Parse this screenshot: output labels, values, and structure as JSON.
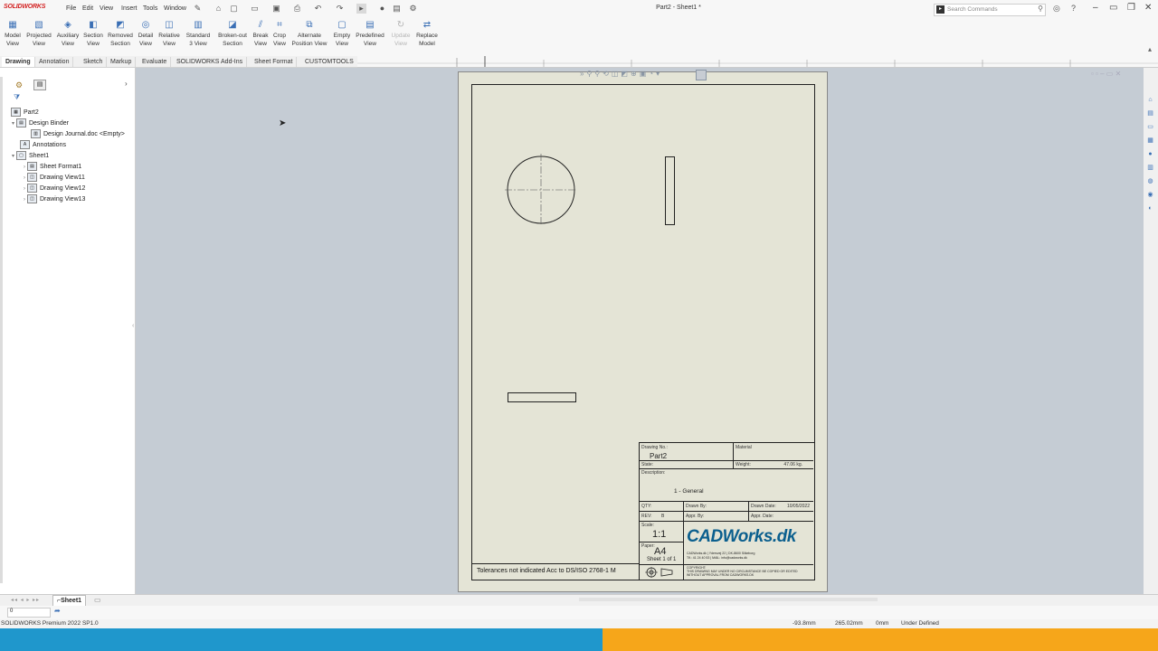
{
  "app": {
    "logo_text": "SOLIDWORKS",
    "title": "Part2 - Sheet1 *",
    "menu": [
      "File",
      "Edit",
      "View",
      "Insert",
      "Tools",
      "Window"
    ],
    "search_placeholder": "Search Commands"
  },
  "ribbon": {
    "buttons": [
      {
        "label": "Model\nView",
        "icon": "model-view-icon",
        "enabled": true
      },
      {
        "label": "Projected\nView",
        "icon": "projected-view-icon",
        "enabled": true
      },
      {
        "label": "Auxiliary\nView",
        "icon": "auxiliary-view-icon",
        "enabled": true
      },
      {
        "label": "Section\nView",
        "icon": "section-view-icon",
        "enabled": true
      },
      {
        "label": "Removed\nSection",
        "icon": "removed-section-icon",
        "enabled": true
      },
      {
        "label": "Detail\nView",
        "icon": "detail-view-icon",
        "enabled": true
      },
      {
        "label": "Relative\nView",
        "icon": "relative-view-icon",
        "enabled": true
      },
      {
        "label": "Standard\n3 View",
        "icon": "standard-3-view-icon",
        "enabled": true
      },
      {
        "label": "Broken-out\nSection",
        "icon": "broken-out-section-icon",
        "enabled": true
      },
      {
        "label": "Break\nView",
        "icon": "break-view-icon",
        "enabled": true
      },
      {
        "label": "Crop\nView",
        "icon": "crop-view-icon",
        "enabled": true
      },
      {
        "label": "Alternate\nPosition View",
        "icon": "alternate-position-view-icon",
        "enabled": true
      },
      {
        "label": "Empty\nView",
        "icon": "empty-view-icon",
        "enabled": true
      },
      {
        "label": "Predefined\nView",
        "icon": "predefined-view-icon",
        "enabled": true
      },
      {
        "label": "Update\nView",
        "icon": "update-view-icon",
        "enabled": false
      },
      {
        "label": "Replace\nModel",
        "icon": "replace-model-icon",
        "enabled": true
      }
    ]
  },
  "tabs": [
    "Drawing",
    "Annotation",
    "Sketch",
    "Markup",
    "Evaluate",
    "SOLIDWORKS Add-Ins",
    "Sheet Format",
    "CUSTOMTOOLS"
  ],
  "active_tab": "Drawing",
  "tree": {
    "root": "Part2",
    "design_binder": "Design Binder",
    "design_journal": "Design Journal.doc <Empty>",
    "annotations": "Annotations",
    "sheet": "Sheet1",
    "sheet_format": "Sheet Format1",
    "views": [
      "Drawing View11",
      "Drawing View12",
      "Drawing View13"
    ]
  },
  "title_block": {
    "drawing_no_label": "Drawing No.:",
    "drawing_no": "Part2",
    "material_label": "Material",
    "state_label": "State:",
    "weight_label": "Weight:",
    "weight": "47.06 kg.",
    "description_label": "Description:",
    "description": "1 - General",
    "qty_label": "QTY:",
    "drawn_by_label": "Drawn By:",
    "drawn_date_label": "Drawn Date:",
    "drawn_date": "10/05/2022",
    "rev_label": "REV:",
    "rev": "B",
    "appr_by_label": "Appr. By:",
    "appr_date_label": "Appr. Date:",
    "scale_label": "Scale:",
    "scale": "1:1",
    "paper_label": "Paper:",
    "paper": "A4",
    "sheet_of": "Sheet 1 of 1",
    "company": "CADWorks.dk",
    "company_address": "CADWorks.dk | Ydersvej 22 | DK-8600 Silkeborg",
    "company_contact": "Tlf.: 41 24 40 53 | MAIL: info@cadworks.dk",
    "copyright_title": "COPYRIGHT:",
    "copyright_text": "THIS DRAWING MAY UNDER NO CIRCUMSTANCE BE COPIED OR EDITED WITHOUT APPROVAL FROM CADWORKS.DK",
    "tolerances": "Tolerances not indicated Acc to DS/ISO 2768-1 M"
  },
  "sheet_tabs": {
    "active": "Sheet1",
    "zoom_field": "0"
  },
  "status": {
    "product": "SOLIDWORKS Premium 2022 SP1.0",
    "x": "-93.8mm",
    "y": "265.02mm",
    "z": "0mm",
    "state": "Under Defined"
  }
}
